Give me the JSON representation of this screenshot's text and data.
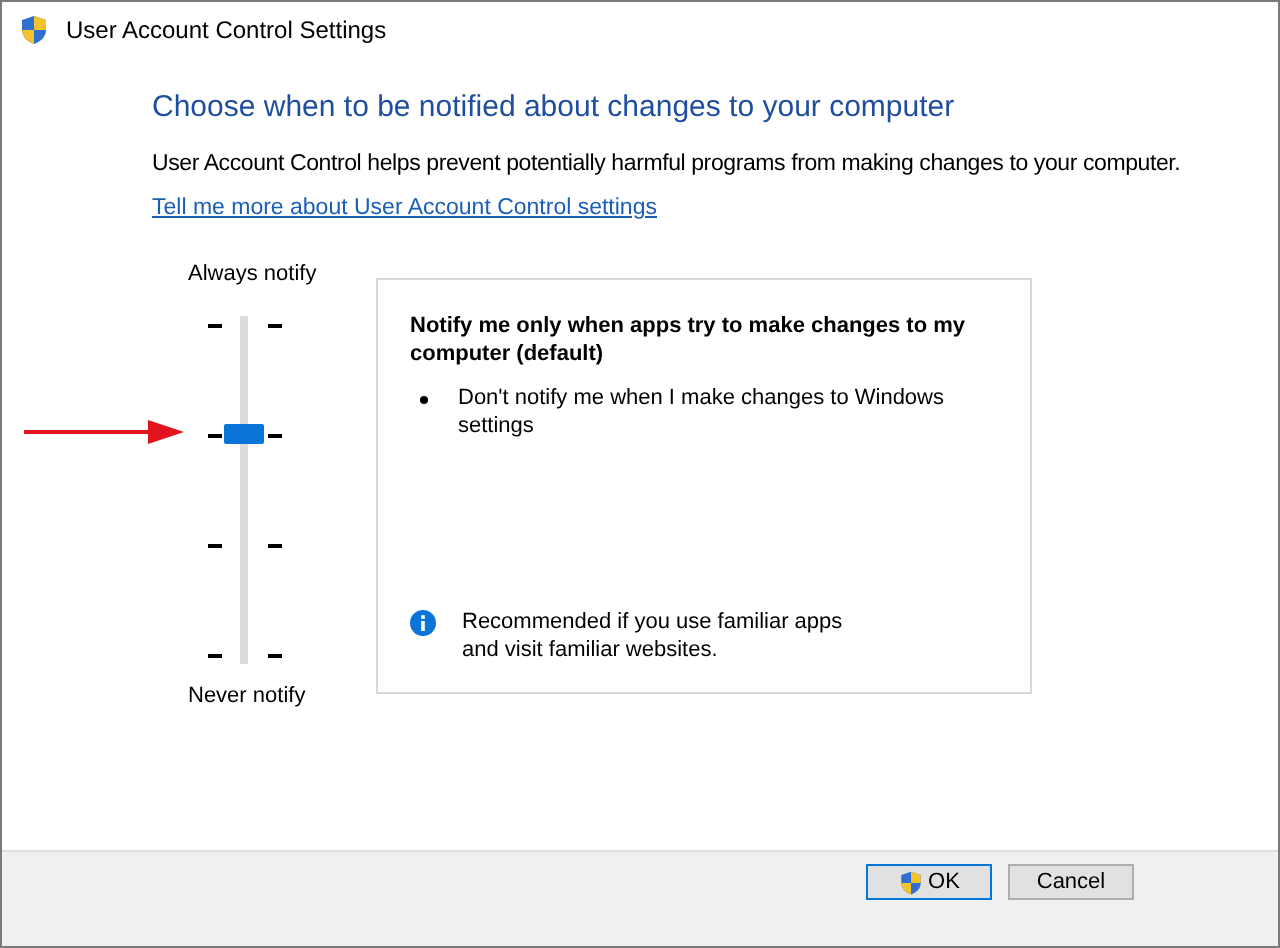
{
  "window": {
    "title": "User Account Control Settings"
  },
  "heading": "Choose when to be notified about changes to your computer",
  "description": "User Account Control helps prevent potentially harmful programs from making changes to your computer.",
  "link": "Tell me more about User Account Control settings",
  "slider": {
    "top_label": "Always notify",
    "bottom_label": "Never notify",
    "level": 0.667
  },
  "panel": {
    "title": "Notify me only when apps try to make changes to my computer (default)",
    "bullets": [
      "Don't notify me when I make changes to Windows settings"
    ],
    "note": "Recommended if you use familiar apps and visit familiar websites."
  },
  "buttons": [
    {
      "label": "OK",
      "kind": "shield"
    },
    {
      "label": "Cancel",
      "kind": "plain"
    }
  ]
}
